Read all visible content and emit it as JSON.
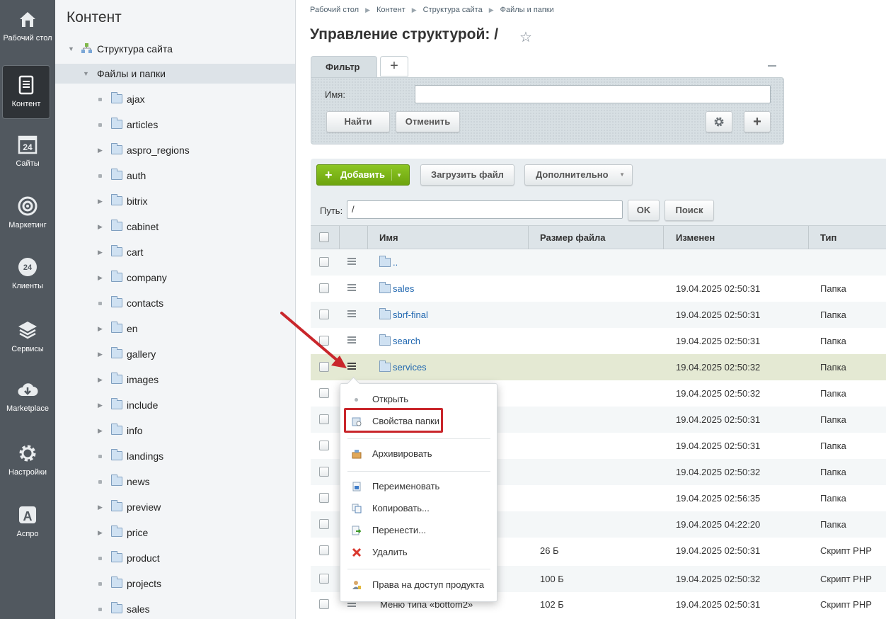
{
  "leftnav": {
    "items": [
      {
        "label": "Рабочий стол",
        "icon": "home-icon"
      },
      {
        "label": "Контент",
        "icon": "document-icon",
        "active": true
      },
      {
        "label": "Сайты",
        "icon": "calendar-24-icon"
      },
      {
        "label": "Маркетинг",
        "icon": "target-icon"
      },
      {
        "label": "Клиенты",
        "icon": "crm-24-icon"
      },
      {
        "label": "Сервисы",
        "icon": "layers-icon"
      },
      {
        "label": "Marketplace",
        "icon": "cloud-download-icon"
      },
      {
        "label": "Настройки",
        "icon": "gear-icon"
      },
      {
        "label": "Аспро",
        "icon": "letter-a-icon"
      }
    ]
  },
  "tree": {
    "title": "Контент",
    "root": "Структура сайта",
    "selected": "Файлы и папки",
    "items": [
      {
        "label": "ajax",
        "expandable": false
      },
      {
        "label": "articles",
        "expandable": false
      },
      {
        "label": "aspro_regions",
        "expandable": true
      },
      {
        "label": "auth",
        "expandable": false
      },
      {
        "label": "bitrix",
        "expandable": true
      },
      {
        "label": "cabinet",
        "expandable": true
      },
      {
        "label": "cart",
        "expandable": true
      },
      {
        "label": "company",
        "expandable": true
      },
      {
        "label": "contacts",
        "expandable": false
      },
      {
        "label": "en",
        "expandable": true
      },
      {
        "label": "gallery",
        "expandable": true
      },
      {
        "label": "images",
        "expandable": true
      },
      {
        "label": "include",
        "expandable": true
      },
      {
        "label": "info",
        "expandable": true
      },
      {
        "label": "landings",
        "expandable": false
      },
      {
        "label": "news",
        "expandable": false
      },
      {
        "label": "preview",
        "expandable": true
      },
      {
        "label": "price",
        "expandable": true
      },
      {
        "label": "product",
        "expandable": false
      },
      {
        "label": "projects",
        "expandable": false
      },
      {
        "label": "sales",
        "expandable": false
      }
    ]
  },
  "breadcrumb": [
    "Рабочий стол",
    "Контент",
    "Структура сайта",
    "Файлы и папки"
  ],
  "page_title": "Управление структурой: /",
  "filter": {
    "tab_label": "Фильтр",
    "add_tab": "+",
    "name_label": "Имя:",
    "name_value": "",
    "find_label": "Найти",
    "cancel_label": "Отменить",
    "add_field": "+"
  },
  "toolbar": {
    "add_label": "Добавить",
    "upload_label": "Загрузить файл",
    "more_label": "Дополнительно"
  },
  "pathbar": {
    "label": "Путь:",
    "value": "/",
    "ok_label": "OK",
    "search_label": "Поиск"
  },
  "table": {
    "columns": [
      "Имя",
      "Размер файла",
      "Изменен",
      "Тип"
    ],
    "rows": [
      {
        "name": "..",
        "size": "",
        "date": "",
        "type": "",
        "kind": "up"
      },
      {
        "name": "sales",
        "size": "",
        "date": "19.04.2025 02:50:31",
        "type": "Папка",
        "kind": "folder"
      },
      {
        "name": "sbrf-final",
        "size": "",
        "date": "19.04.2025 02:50:31",
        "type": "Папка",
        "kind": "folder"
      },
      {
        "name": "search",
        "size": "",
        "date": "19.04.2025 02:50:31",
        "type": "Папка",
        "kind": "folder"
      },
      {
        "name": "services",
        "size": "",
        "date": "19.04.2025 02:50:32",
        "type": "Папка",
        "kind": "folder",
        "highlighted": true
      },
      {
        "name": "",
        "size": "",
        "date": "19.04.2025 02:50:32",
        "type": "Папка",
        "kind": "folder"
      },
      {
        "name": "",
        "size": "",
        "date": "19.04.2025 02:50:31",
        "type": "Папка",
        "kind": "folder"
      },
      {
        "name": "",
        "size": "",
        "date": "19.04.2025 02:50:31",
        "type": "Папка",
        "kind": "folder"
      },
      {
        "name": "",
        "size": "",
        "date": "19.04.2025 02:50:32",
        "type": "Папка",
        "kind": "folder"
      },
      {
        "name": "",
        "size": "",
        "date": "19.04.2025 02:56:35",
        "type": "Папка",
        "kind": "folder"
      },
      {
        "name": "",
        "size": "",
        "date": "19.04.2025 04:22:20",
        "type": "Папка",
        "kind": "folder"
      },
      {
        "name": "",
        "size": "26 Б",
        "date": "19.04.2025 02:50:31",
        "type": "Скрипт PHP",
        "kind": "file"
      },
      {
        "name": "",
        "size": "100 Б",
        "date": "19.04.2025 02:50:32",
        "type": "Скрипт PHP",
        "kind": "file"
      },
      {
        "name": "Меню типа «bottom2»",
        "size": "102 Б",
        "date": "19.04.2025 02:50:31",
        "type": "Скрипт PHP",
        "kind": "file"
      }
    ]
  },
  "context_menu": {
    "items": [
      {
        "label": "Открыть",
        "icon": "dot-icon"
      },
      {
        "label": "Свойства папки",
        "icon": "folder-properties-icon"
      },
      {
        "label": "Архивировать",
        "icon": "archive-box-icon"
      },
      {
        "label": "Переименовать",
        "icon": "rename-icon"
      },
      {
        "label": "Копировать...",
        "icon": "copy-icon"
      },
      {
        "label": "Перенести...",
        "icon": "move-icon"
      },
      {
        "label": "Удалить",
        "icon": "delete-x-icon"
      },
      {
        "label": "Права на доступ продукта",
        "icon": "access-rights-icon"
      }
    ]
  },
  "colors": {
    "nav_bg": "#51585f",
    "add_button": "#7ab51a",
    "link": "#2067b0",
    "highlight_row": "#e4e9d3",
    "annotation_red": "#c9262b"
  }
}
